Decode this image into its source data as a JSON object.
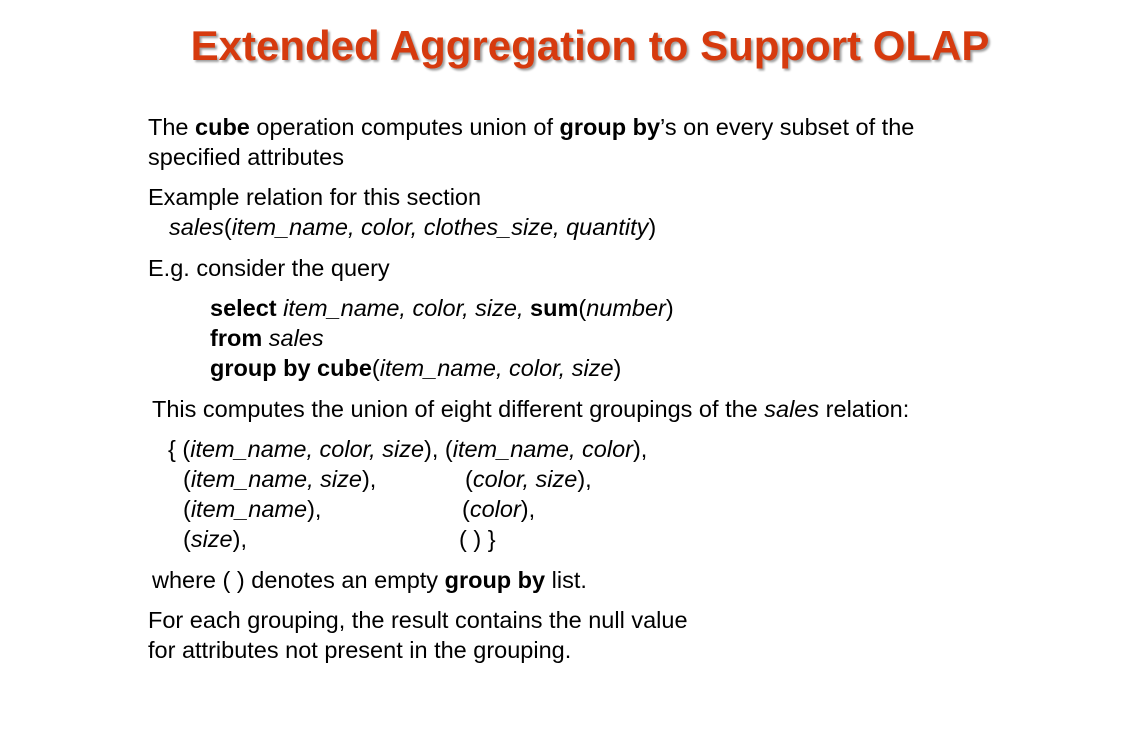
{
  "title": "Extended Aggregation to Support OLAP",
  "p1": {
    "t1": "The ",
    "cube": "cube",
    "t2": " operation computes union of ",
    "group_by": "group by",
    "t3": "’s on every subset of the",
    "line2": "specified attributes"
  },
  "p2": {
    "line1": "Example relation for this section",
    "rel": "sales",
    "open": "(",
    "attrs": "item_name, color, clothes_size, quantity",
    "close": ")"
  },
  "p3": {
    "line1": "E.g. consider the query"
  },
  "query": {
    "select_kw": "select",
    "select_attrs": "item_name, color, size,",
    "sum_kw": "sum",
    "sum_open": "(",
    "sum_arg": "number",
    "sum_close": ")",
    "from_kw": "from",
    "from_rel": "sales",
    "groupby_kw": "group by cube",
    "gb_open": "(",
    "gb_attrs": "item_name, color, size",
    "gb_close": ")"
  },
  "p4": {
    "t1": "This computes the union of eight different groupings of the ",
    "rel": "sales",
    "t2": " relation:"
  },
  "groupings": {
    "g1_pre": "{ (",
    "g1": "item_name, color, size",
    "g1_post": "), (",
    "g2": "item_name, color",
    "g2_post": "),",
    "g3_pre": "(",
    "g3": "item_name, size",
    "g3_post": "),",
    "g4_pre": "(",
    "g4": "color, size",
    "g4_post": "),",
    "g5_pre": "(",
    "g5": "item_name",
    "g5_post": "),",
    "g6_pre": "(",
    "g6": "color",
    "g6_post": "),",
    "g7_pre": "(",
    "g7": "size",
    "g7_post": "),",
    "g8": "( ) }"
  },
  "p5": {
    "t1": "where ( ) denotes an empty ",
    "group_by": "group by",
    "t2": " list."
  },
  "p6": {
    "line1": "For each grouping, the result contains the null value",
    "line2": "for attributes not present in the grouping."
  }
}
